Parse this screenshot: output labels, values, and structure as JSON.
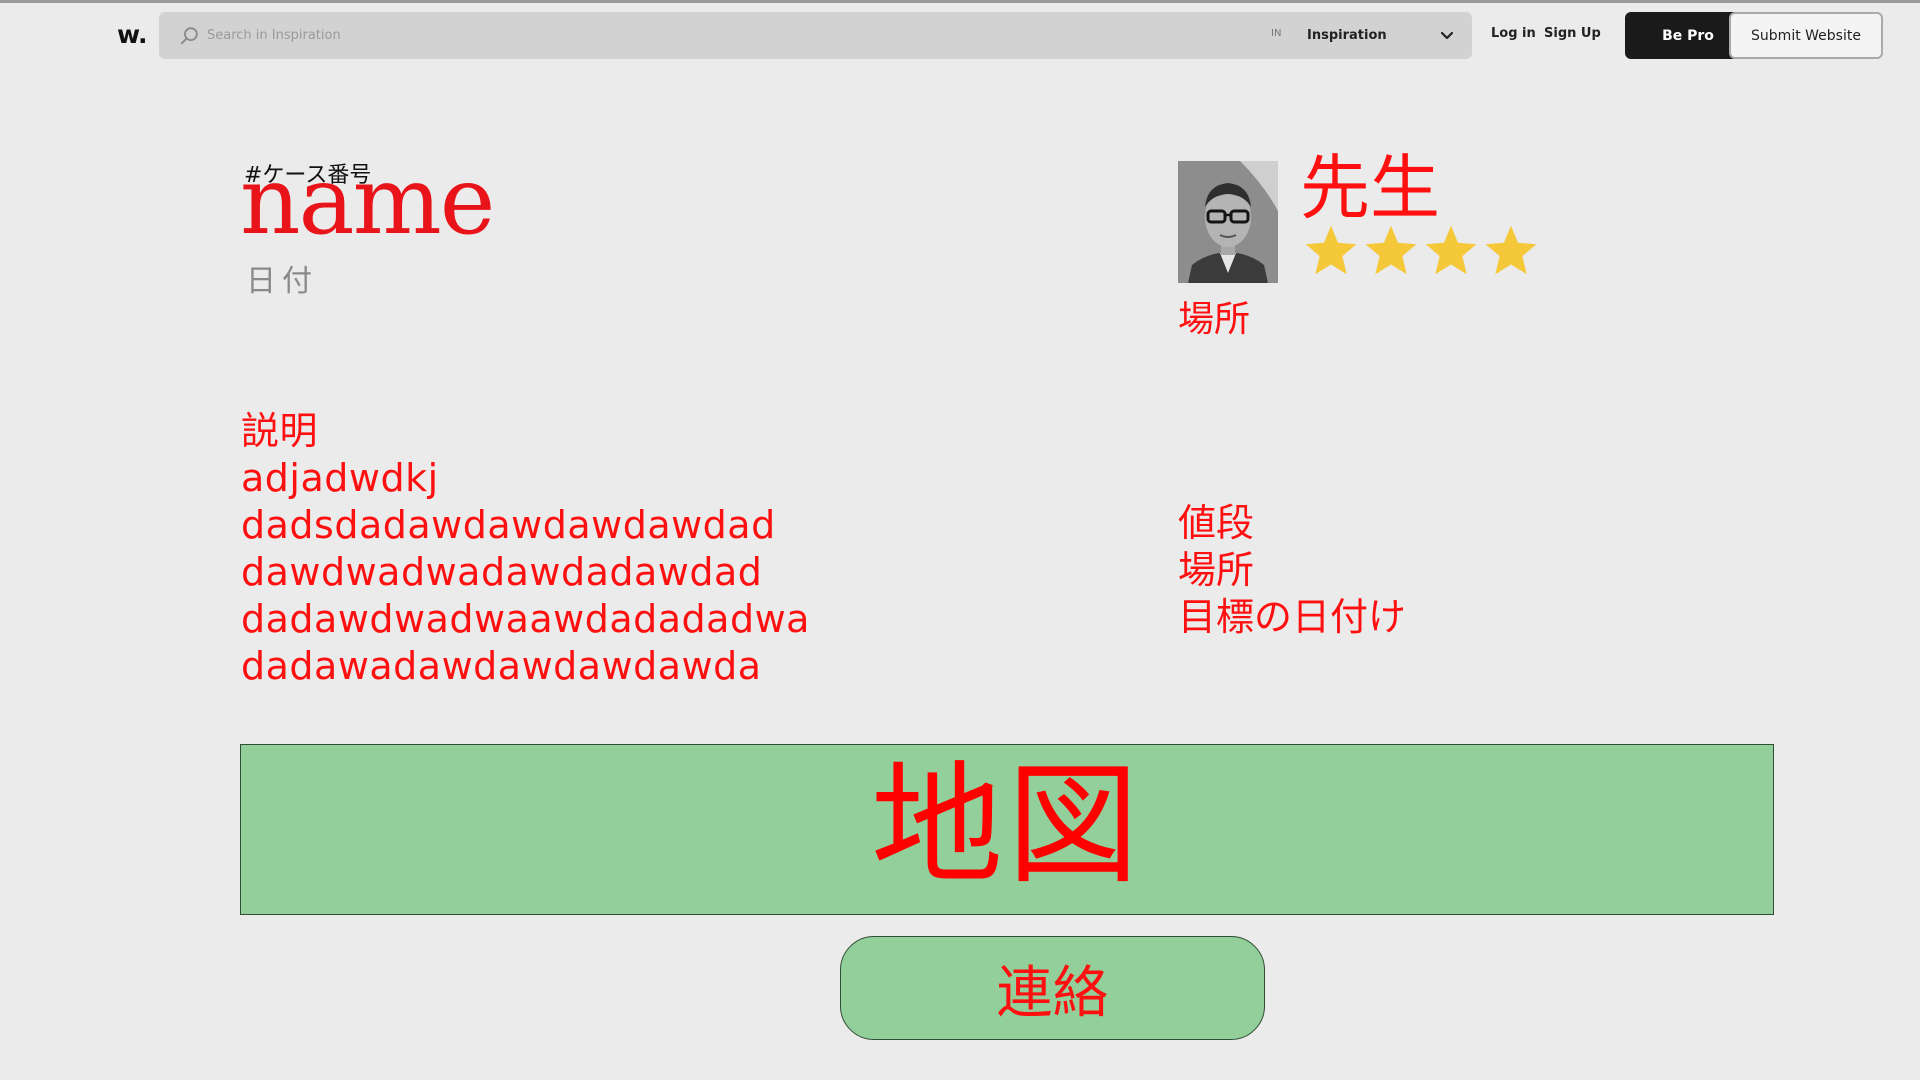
{
  "header": {
    "logo": "w.",
    "search": {
      "placeholder": "Search in Inspiration",
      "value": ""
    },
    "scope": {
      "prefix": "IN",
      "selected": "Inspiration"
    },
    "login_label": "Log in",
    "signup_label": "Sign Up",
    "bepro_label": "Be Pro",
    "submit_label": "Submit Website"
  },
  "case": {
    "number_label": "#ケース番号",
    "name": "name",
    "date_label": "日付"
  },
  "teacher": {
    "title": "先生",
    "rating": 4,
    "rating_max": 4,
    "location": "場所"
  },
  "description": {
    "heading": "説明",
    "lines": [
      "adjadwdkj",
      "dadsdadawdawdawdawdad",
      "dawdwadwadawdadawdad",
      "dadawdwadwaawdadadadwa",
      "dadawadawdawdawdawda"
    ]
  },
  "details": {
    "price_label": "値段",
    "location_label": "場所",
    "target_date_label": "目標の日付け"
  },
  "map": {
    "label": "地図"
  },
  "contact": {
    "label": "連絡"
  },
  "colors": {
    "accent_red": "#ff1010",
    "map_green": "#92cf9b",
    "star_yellow": "#f5c83a",
    "page_bg": "#ebebeb"
  }
}
